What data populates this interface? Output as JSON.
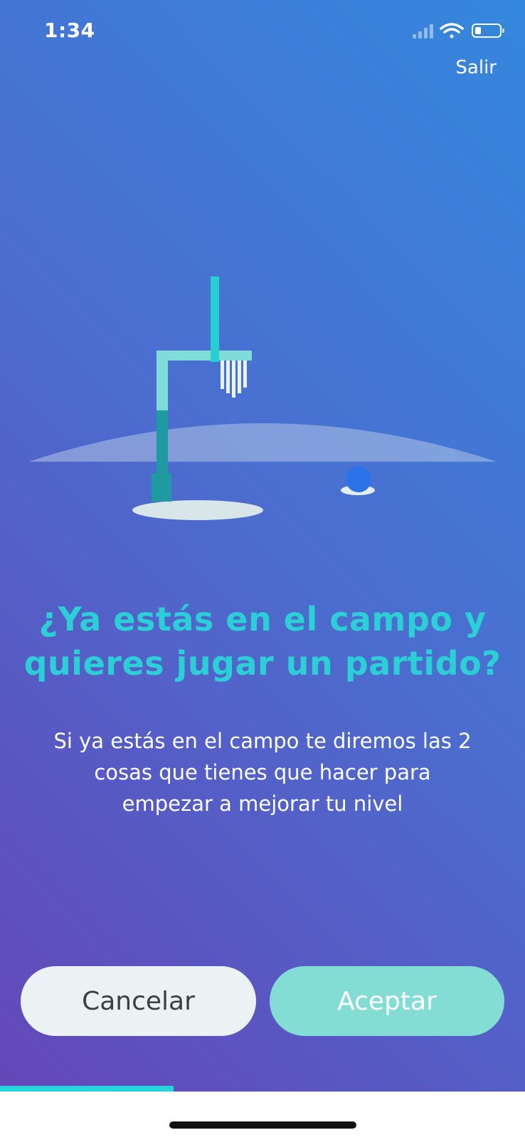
{
  "status_bar": {
    "time": "1:34",
    "icons": [
      "signal-icon",
      "wifi-icon",
      "battery-icon"
    ]
  },
  "header": {
    "exit_label": "Salir"
  },
  "illustration": {
    "icon": "football-goal-illustration"
  },
  "content": {
    "title_lines": [
      "¿Ya estás en el campo y",
      "quieres jugar un partido?"
    ],
    "description_lines": [
      "Si ya estás en el campo te diremos las 2",
      "cosas que tienes que hacer para",
      "empezar a mejorar tu nivel"
    ]
  },
  "actions": {
    "cancel_label": "Cancelar",
    "accept_label": "Aceptar"
  },
  "progress": {
    "fraction": 0.33
  },
  "colors": {
    "gradient_start": "#3487de",
    "gradient_end": "#6447b8",
    "accent_cyan": "#2bd0d6",
    "accept_button": "#84ddd4",
    "cancel_button": "#eaf2f4"
  }
}
